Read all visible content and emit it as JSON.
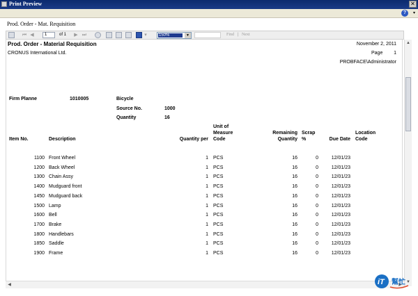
{
  "window": {
    "title": "Print Preview",
    "close_glyph": "✕"
  },
  "menubar": {
    "help_icon": "help-icon",
    "help_glyph": "?",
    "dropdown_glyph": "▾"
  },
  "breadcrumb": "Prod. Order - Mat. Requisition",
  "toolbar": {
    "page_value": "1",
    "of_text": "of 1",
    "zoom_value": "150%",
    "find_label": "Find",
    "separator": "|",
    "next_label": "Next",
    "icons": [
      "toc-icon",
      "first-page-icon",
      "previous-page-icon",
      "next-page-icon",
      "last-page-icon",
      "stop-icon",
      "print-icon",
      "print-layout-icon",
      "page-setup-icon",
      "export-icon",
      "export-dropdown-icon"
    ]
  },
  "report": {
    "title": "Prod. Order - Material Requisition",
    "date": "November 2, 2011",
    "page_label": "Page",
    "page_number": "1",
    "company": "CRONUS International Ltd.",
    "user": "PROBFACE\\Administrator",
    "order": {
      "status": "Firm Planne",
      "number": "1010005",
      "item": "Bicycle",
      "source_no_label": "Source No.",
      "source_no": "1000",
      "quantity_label": "Quantity",
      "quantity": "16"
    },
    "columns": {
      "item_no": "Item No.",
      "description": "Description",
      "quantity_per": "Quantity per",
      "uom": [
        "Unit of",
        "Measure",
        "Code"
      ],
      "remaining": [
        "Remaining",
        "Quantity"
      ],
      "scrap": [
        "Scrap",
        "%"
      ],
      "due_date": "Due Date",
      "location": [
        "Location",
        "Code"
      ]
    },
    "rows": [
      {
        "item_no": "1100",
        "description": "Front Wheel",
        "qty_per": "1",
        "uom": "PCS",
        "remaining": "16",
        "scrap": "0",
        "due_date": "12/01/23"
      },
      {
        "item_no": "1200",
        "description": "Back Wheel",
        "qty_per": "1",
        "uom": "PCS",
        "remaining": "16",
        "scrap": "0",
        "due_date": "12/01/23"
      },
      {
        "item_no": "1300",
        "description": "Chain Assy",
        "qty_per": "1",
        "uom": "PCS",
        "remaining": "16",
        "scrap": "0",
        "due_date": "12/01/23"
      },
      {
        "item_no": "1400",
        "description": "Mudguard front",
        "qty_per": "1",
        "uom": "PCS",
        "remaining": "16",
        "scrap": "0",
        "due_date": "12/01/23"
      },
      {
        "item_no": "1450",
        "description": "Mudguard back",
        "qty_per": "1",
        "uom": "PCS",
        "remaining": "16",
        "scrap": "0",
        "due_date": "12/01/23"
      },
      {
        "item_no": "1500",
        "description": "Lamp",
        "qty_per": "1",
        "uom": "PCS",
        "remaining": "16",
        "scrap": "0",
        "due_date": "12/01/23"
      },
      {
        "item_no": "1600",
        "description": "Bell",
        "qty_per": "1",
        "uom": "PCS",
        "remaining": "16",
        "scrap": "0",
        "due_date": "12/01/23"
      },
      {
        "item_no": "1700",
        "description": "Brake",
        "qty_per": "1",
        "uom": "PCS",
        "remaining": "16",
        "scrap": "0",
        "due_date": "12/01/23"
      },
      {
        "item_no": "1800",
        "description": "Handlebars",
        "qty_per": "1",
        "uom": "PCS",
        "remaining": "16",
        "scrap": "0",
        "due_date": "12/01/23"
      },
      {
        "item_no": "1850",
        "description": "Saddle",
        "qty_per": "1",
        "uom": "PCS",
        "remaining": "16",
        "scrap": "0",
        "due_date": "12/01/23"
      },
      {
        "item_no": "1900",
        "description": "Frame",
        "qty_per": "1",
        "uom": "PCS",
        "remaining": "16",
        "scrap": "0",
        "due_date": "12/01/23"
      }
    ]
  },
  "watermark": {
    "text": "iT",
    "sub": "幫忙",
    "color_primary": "#1a6fc4",
    "color_accent": "#e04a2a"
  }
}
